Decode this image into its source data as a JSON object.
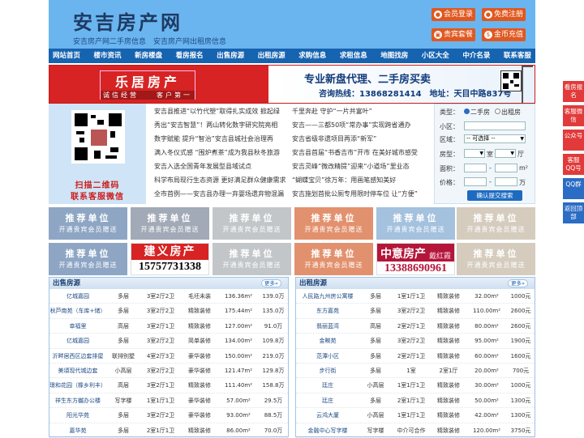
{
  "header": {
    "logo": "安吉房产网",
    "slogan": "安吉房产网二手房信息　安吉房产网出租房信息",
    "buttons": [
      {
        "label": "会员登录",
        "icon": "user-icon"
      },
      {
        "label": "免费注册",
        "icon": "user-icon"
      },
      {
        "label": "贵宾套餐",
        "icon": "gift-icon"
      },
      {
        "label": "金币充值",
        "icon": "coin-icon"
      }
    ]
  },
  "nav": [
    "网站首页",
    "楼市资讯",
    "新房楼盘",
    "看房报名",
    "出售房源",
    "出租房源",
    "求购信息",
    "求租信息",
    "地图找房",
    "小区大全",
    "中介名录",
    "联系客服"
  ],
  "banner": {
    "left_title": "乐居房产",
    "left_sub": "诚信经营　　客户第一",
    "right_line1": "专业新盘代理、二手房买卖",
    "right_line2": "咨询热线：13868281414　地址：天目中路837号"
  },
  "qr": {
    "line1": "扫描二维码",
    "line2": "联系客服微信"
  },
  "news": [
    [
      "安吉县推进“以竹代塑”取得扎实成效 掀起绿",
      "千里奔赴 守护“一片共富叶”"
    ],
    [
      "秀出“安吉智慧”！两山转化数字研究院亮相",
      "安吉——三都50项“常办事”实现跨省通办"
    ],
    [
      "数字赋能 提升“智治”安吉县城社会治理再",
      "安吉省级非遗项目再添“新军”"
    ],
    [
      "满入冬仪式感 “围炉煮茶”成为我县秋冬旅游",
      "安吉县首届“书香吉市”开市 在美好城市感受"
    ],
    [
      "安吉入选全国青年发展型县域试点",
      "安吉灵峰“微改精提”迎来“小道场”里业态"
    ],
    [
      "科学布局现行生态资源 更好满足群众健康需求",
      "“蝴蝶宝贝”徐万年：用画笔感知美好"
    ],
    [
      "全市首例——安吉县办理一弃婴场遗弃物混漏",
      "安吉施划首批公厕专用限时停车位 让“方便”"
    ]
  ],
  "search": {
    "type_label": "类型：",
    "type_options": [
      "二手房",
      "出租房"
    ],
    "community_label": "小区：",
    "area_label": "区域：",
    "area_value": "-- 可选择 --",
    "layout_label": "房型：",
    "layout_unit1": "室",
    "layout_unit2": "厅",
    "size_label": "面积：",
    "size_sep": "-",
    "size_unit": "m²",
    "price_label": "价格：",
    "price_unit": "万",
    "submit": "确认提交搜索"
  },
  "ads": {
    "recommend_title": "推荐单位",
    "recommend_sub": "开通贵宾会员赠送",
    "jianyi_name": "建义房产",
    "jianyi_phone": "15757731338",
    "zhongyi_name": "中意房产",
    "zhongyi_person": "戴红霞",
    "zhongyi_phone": "13388690961"
  },
  "sale": {
    "title": "出售房源",
    "more": "更多»",
    "rows": [
      [
        "亿城嘉园",
        "多层",
        "3室2厅2卫",
        "毛坯未装",
        "136.36m²",
        "139.0万"
      ],
      [
        "秋芦南苑（车库+储）",
        "多层",
        "3室2厅2卫",
        "精致装修",
        "175.44m²",
        "135.0万"
      ],
      [
        "幸福里",
        "高层",
        "3室2厅1卫",
        "精致装修",
        "127.00m²",
        "91.0万"
      ],
      [
        "亿城嘉园",
        "多层",
        "3室2厅2卫",
        "简单装修",
        "134.00m²",
        "109.8万"
      ],
      [
        "沂畔居西区边套排屋",
        "联排别墅",
        "4室2厅3卫",
        "豪华装修",
        "150.00m²",
        "219.0万"
      ],
      [
        "美頌现代城边套",
        "小高层",
        "3室2厅2卫",
        "豪华装修",
        "121.47m²",
        "129.8万"
      ],
      [
        "璟和花园（橡乡利丰）",
        "高层",
        "3室2厅1卫",
        "精致装修",
        "111.40m²",
        "158.8万"
      ],
      [
        "祥生东方樾办公楼",
        "写字楼",
        "1室1厅1卫",
        "豪华装修",
        "57.00m²",
        "29.5万"
      ],
      [
        "阳光华苑",
        "多层",
        "3室2厅2卫",
        "豪华装修",
        "93.00m²",
        "88.5万"
      ],
      [
        "嘉华苑",
        "多层",
        "2室1厅1卫",
        "精致装修",
        "86.00m²",
        "70.0万"
      ]
    ]
  },
  "rent": {
    "title": "出租房源",
    "more": "更多»",
    "rows": [
      [
        "人民路九州房公寓楼",
        "多层",
        "1室1厅1卫",
        "精致装修",
        "32.00m²",
        "1000元"
      ],
      [
        "东方嘉苑",
        "多层",
        "3室2厅2卫",
        "精致装修",
        "110.00m²",
        "2600元"
      ],
      [
        "翡丽蓝湾",
        "高层",
        "2室2厅1卫",
        "精致装修",
        "80.00m²",
        "2600元"
      ],
      [
        "金畹苑",
        "多层",
        "3室2厅2卫",
        "精致装修",
        "95.00m²",
        "1900元"
      ],
      [
        "范潭小区",
        "多层",
        "2室2厅1卫",
        "精致装修",
        "60.00m²",
        "1600元"
      ],
      [
        "步行街",
        "多层",
        "1室",
        "2室1厅",
        "20.00m²",
        "700元"
      ],
      [
        "廷庄",
        "小高层",
        "1室1厅1卫",
        "精致装修",
        "30.00m²",
        "1000元"
      ],
      [
        "廷庄",
        "多层",
        "2室1厅1卫",
        "精致装修",
        "50.00m²",
        "1300元"
      ],
      [
        "云鸿大厦",
        "小高层",
        "1室1厅1卫",
        "精致装修",
        "42.00m²",
        "1300元"
      ],
      [
        "金融中心写字楼",
        "写字楼",
        "中介可合作",
        "精致装修",
        "120.00m²",
        "3750元"
      ]
    ]
  },
  "sidebar": [
    {
      "label": "看房报名",
      "color": "#e23a3a"
    },
    {
      "label": "客服微信",
      "color": "#e23a3a"
    },
    {
      "label": "公众号",
      "color": "#e23a3a"
    },
    {
      "label": "客服QQ号",
      "color": "#e23a3a"
    },
    {
      "label": "QQ群",
      "color": "#2b6cc4"
    },
    {
      "label": "返回顶部",
      "color": "#2b6cc4"
    }
  ]
}
